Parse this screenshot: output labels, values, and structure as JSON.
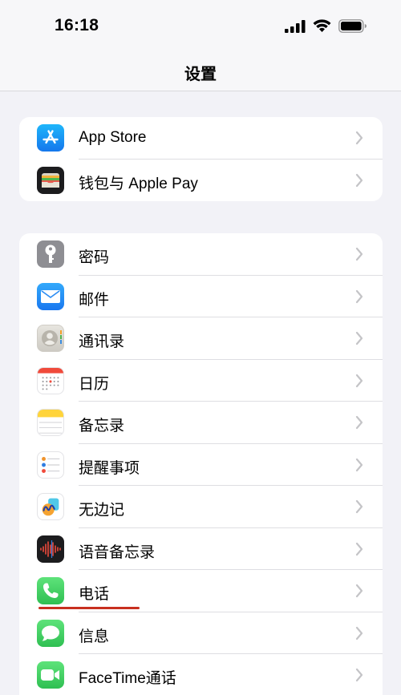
{
  "status_bar": {
    "time": "16:18"
  },
  "nav": {
    "title": "设置"
  },
  "groups": [
    {
      "items": [
        {
          "label": "App Store",
          "icon": "app-store-icon",
          "color": "#1b8cf5"
        },
        {
          "label": "钱包与 Apple Pay",
          "icon": "wallet-icon",
          "color": "#1c1c1e"
        }
      ]
    },
    {
      "items": [
        {
          "label": "密码",
          "icon": "key-icon",
          "color": "#8e8e93"
        },
        {
          "label": "邮件",
          "icon": "mail-icon",
          "color": "#2b8cf3"
        },
        {
          "label": "通讯录",
          "icon": "contacts-icon",
          "color": "#d9d7d2"
        },
        {
          "label": "日历",
          "icon": "calendar-icon",
          "color": "#ffffff"
        },
        {
          "label": "备忘录",
          "icon": "notes-icon",
          "color": "#ffd43b"
        },
        {
          "label": "提醒事项",
          "icon": "reminders-icon",
          "color": "#ffffff"
        },
        {
          "label": "无边记",
          "icon": "freeform-icon",
          "color": "#ffffff"
        },
        {
          "label": "语音备忘录",
          "icon": "voice-memos-icon",
          "color": "#1c1c1e"
        },
        {
          "label": "电话",
          "icon": "phone-icon",
          "color": "#34c759"
        },
        {
          "label": "信息",
          "icon": "messages-icon",
          "color": "#34c759"
        },
        {
          "label": "FaceTime通话",
          "icon": "facetime-icon",
          "color": "#34c759"
        }
      ]
    }
  ],
  "highlight": {
    "target": "电话",
    "color": "#c8301f"
  }
}
